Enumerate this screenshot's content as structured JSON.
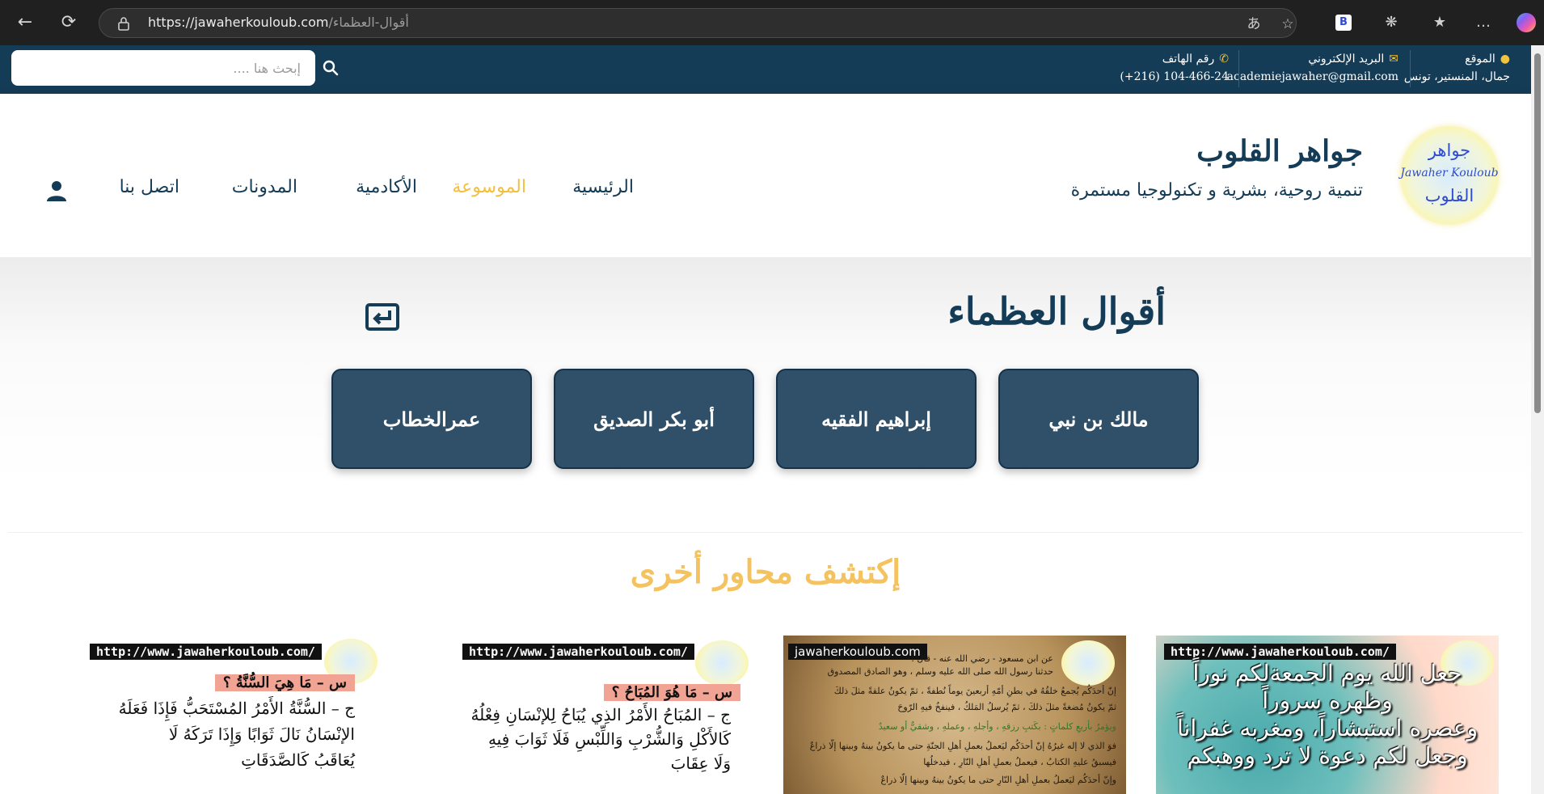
{
  "browser": {
    "url_host": "https://jawaherkouloub.com",
    "url_path": "/أقوال-العظماء",
    "back_icon": "arrow-left",
    "refresh_icon": "refresh",
    "read_aloud_icon": "translate",
    "favorite_icon": "star-outline",
    "tab_icon": "B",
    "extensions_icon": "puzzle",
    "collections_icon": "star-list",
    "more_icon": "…"
  },
  "topbar": {
    "location_label": "الموقع",
    "location_value": "جمال، المنستير، تونس",
    "email_label": "البريد الإلكتروني",
    "email_value": "academiejawaher@gmail.com",
    "phone_label": "رقم الهاتف",
    "phone_value": "104-466-24 (216+)",
    "search_placeholder": "إبحث هنا ....",
    "accent_color": "#f3c33d",
    "bg_color": "#153c57"
  },
  "header": {
    "logo_line1": "جواهر",
    "logo_line2": "Jawaher Kouloub",
    "logo_line3": "القلوب",
    "brand_title": "جواهر القلوب",
    "brand_subtitle": "تنمية روحية، بشرية و تكنولوجيا مستمرة",
    "menu": [
      {
        "label": "الرئيسية"
      },
      {
        "label": "الموسوعة"
      },
      {
        "label": "الأكادمية"
      },
      {
        "label": "المدونات"
      },
      {
        "label": "اتصل بنا"
      }
    ],
    "active_color": "#f4bf3e"
  },
  "hero": {
    "title": "أقوال العظماء",
    "categories": [
      {
        "label": "مالك بن نبي"
      },
      {
        "label": "إبراهيم الفقيه"
      },
      {
        "label": "أبو بكر الصديق"
      },
      {
        "label": "عمرالخطاب"
      }
    ]
  },
  "discover": {
    "title": "إكتشف محاور أخرى"
  },
  "cards": [
    {
      "badge": "http://www.jawaherkouloub.com/",
      "lines": [
        "جعل الله يوم الجمعةلكم نوراً",
        "وظهره سروراً",
        "وعصره استبشاراً، ومغربه غفراناً",
        "وجعل لكم دعوة لا ترد ووهبكم"
      ]
    },
    {
      "badge": "jawaherkouloub.com",
      "lines": [
        "عن ابن مسعود - رضي الله عنه - قال :",
        "حدثنا رسول الله صلى الله عليه وسلم ، وهو الصادق المصدوق",
        "إنّ أحدَكُم يُجمعُ خلقُهُ في بطنِ أمّهِ أربعينَ يوماً نُطفةً ، ثمّ يكونُ علقةً مثلَ ذلكَ",
        "ثمّ يكونُ مُضغةً مثلَ ذلكَ ، ثمّ يُرسلُ المَلكُ ، فينفخُ فيهِ الرّوحَ",
        "ويؤمرُ بأربعِ كلماتٍ : بكَتبِ رزقهِ ، وأجلهِ ، وعملهِ ، وشقيٌّ أو سعيدٌ",
        "فوَ الذي لا إله غيرُهُ إنّ أحدَكُم ليَعملُ بعملِ أهلِ الجنّةِ حتى ما يكونُ بينهُ وبينها إلّا ذراعٌ",
        "فيسبقُ عليهِ الكتابُ ، فيعملُ بعملِ أهلِ النّارِ ، فيدخلُها",
        "وإنّ أحدَكُم ليَعملُ بعملِ أهلِ النّارِ حتى ما يكونُ بينهُ وبينها إلّا ذراعٌ"
      ]
    },
    {
      "badge": "http://www.jawaherkouloub.com/",
      "question": "س – مَا هُوَ المُبَاحُ ؟",
      "lines": [
        "ج – المُبَاحُ الأَمْرُ الذِي يُبَاحُ لِلإنْسَانِ فِعْلُهُ",
        "كَالأَكْلِ وَالشُّرْبِ وَاللِّبْسِ فَلَا ثَوَابَ فِيهِ",
        "وَلَا عِقَابَ"
      ]
    },
    {
      "badge": "http://www.jawaherkouloub.com/",
      "question": "س – مَا هِيَ السُّنَّةُ ؟",
      "lines": [
        "ج – السُّنَّةُ الأَمْرُ المُسْتَحَبُّ فَإِذَا فَعَلَهُ",
        "الإنْسَانُ نَالَ ثَوَابًا وَإِذَا تَرَكَهُ لَا",
        "يُعَاقَبُ كَالصَّدَقَاتِ"
      ]
    }
  ]
}
